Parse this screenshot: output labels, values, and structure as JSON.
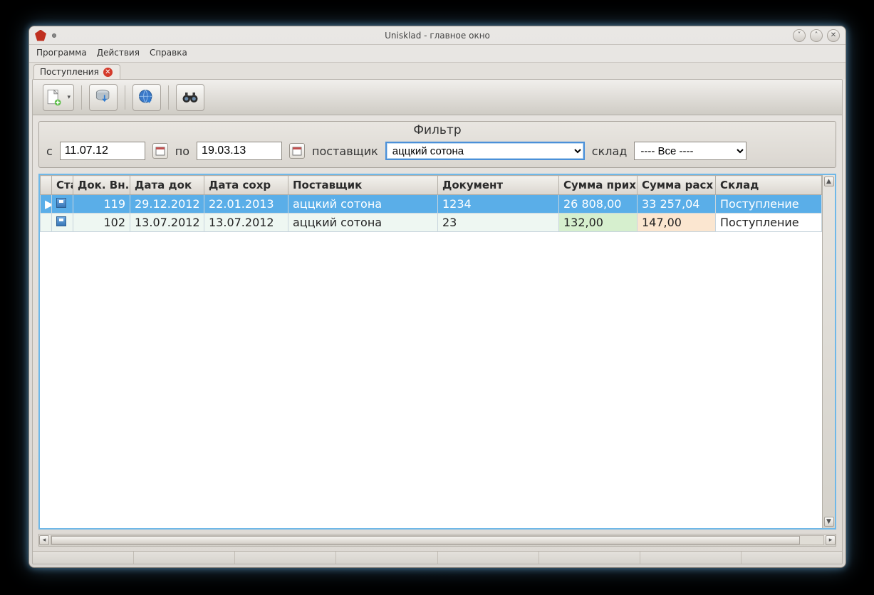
{
  "window": {
    "title": "Unisklad - главное окно"
  },
  "menu": {
    "program": "Программа",
    "actions": "Действия",
    "help": "Справка"
  },
  "tab": {
    "label": "Поступления"
  },
  "filter": {
    "title": "Фильтр",
    "from_label": "с",
    "from_value": "11.07.12",
    "to_label": "по",
    "to_value": "19.03.13",
    "supplier_label": "поставщик",
    "supplier_value": "аццкий сотона",
    "warehouse_label": "склад",
    "warehouse_value": "---- Все ----"
  },
  "grid": {
    "headers": {
      "status": "Ста",
      "doc_vn": "Док. Вн.",
      "date_doc": "Дата док",
      "date_save": "Дата сохр",
      "supplier": "Поставщик",
      "document": "Документ",
      "sum_in": "Сумма прих",
      "sum_out": "Сумма расх",
      "warehouse": "Склад"
    },
    "rows": [
      {
        "doc_vn": "119",
        "date_doc": "29.12.2012",
        "date_save": "22.01.2013",
        "supplier": "аццкий сотона",
        "document": "1234",
        "sum_in": "26 808,00",
        "sum_out": "33 257,04",
        "warehouse": "Поступление"
      },
      {
        "doc_vn": "102",
        "date_doc": "13.07.2012",
        "date_save": "13.07.2012",
        "supplier": "аццкий сотона",
        "document": "23",
        "sum_in": "132,00",
        "sum_out": "147,00",
        "warehouse": "Поступление"
      }
    ]
  }
}
